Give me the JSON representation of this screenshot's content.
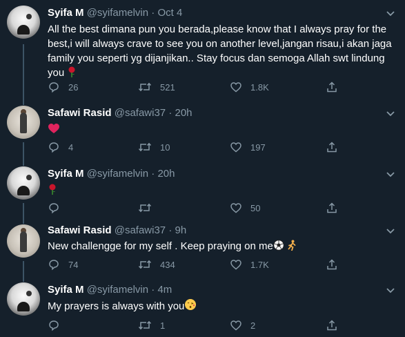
{
  "icons": {
    "reply": "reply-icon",
    "retweet": "retweet-icon",
    "like": "heart-icon",
    "share": "share-icon",
    "caret": "chevron-down-icon",
    "rose": "rose-emoji",
    "heart_emoji": "red-heart-emoji",
    "soccer": "soccer-ball-emoji",
    "runner": "person-running-emoji",
    "kiss": "kissing-face-emoji"
  },
  "colors": {
    "background": "#15202b",
    "muted": "#8899a6",
    "divider": "#38444d",
    "thread": "#3d5466",
    "heart": "#e0245e"
  },
  "tweets": [
    {
      "name": "Syifa M",
      "handle": "@syifamelvin",
      "dot": "·",
      "time": "Oct 4",
      "text": "All the best dimana pun you berada,please know that I always pray for the best,i will always crave to see you on another level,jangan risau,i akan jaga family you seperti yg dijanjikan.. Stay focus dan semoga Allah swt lindung you",
      "replies": "26",
      "retweets": "521",
      "likes": "1.8K"
    },
    {
      "name": "Safawi Rasid",
      "handle": "@safawi37",
      "dot": "·",
      "time": "20h",
      "text": "",
      "replies": "4",
      "retweets": "10",
      "likes": "197"
    },
    {
      "name": "Syifa M",
      "handle": "@syifamelvin",
      "dot": "·",
      "time": "20h",
      "text": "",
      "replies": "",
      "retweets": "",
      "likes": "50"
    },
    {
      "name": "Safawi Rasid",
      "handle": "@safawi37",
      "dot": "·",
      "time": "9h",
      "text": "New challengge for my self . Keep praying on me",
      "replies": "74",
      "retweets": "434",
      "likes": "1.7K"
    },
    {
      "name": "Syifa M",
      "handle": "@syifamelvin",
      "dot": "·",
      "time": "4m",
      "text": "My prayers is always with you",
      "replies": "",
      "retweets": "1",
      "likes": "2"
    }
  ]
}
